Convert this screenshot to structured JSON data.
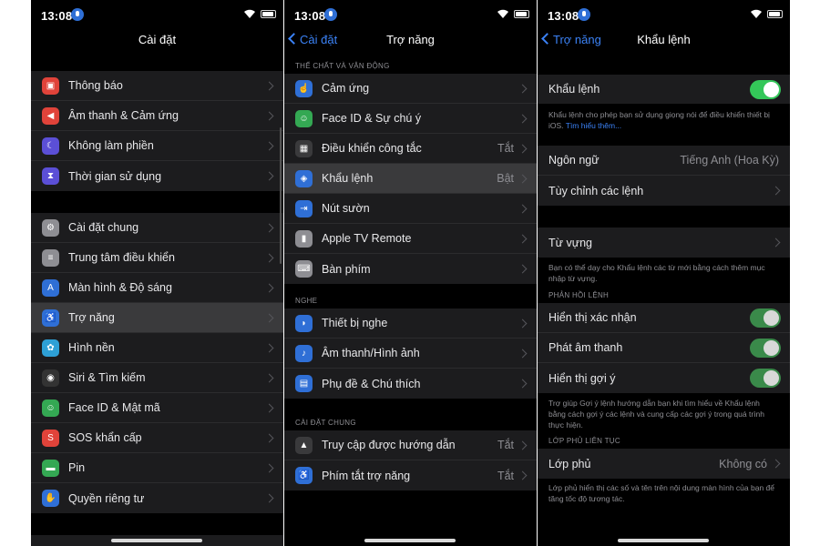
{
  "status": {
    "time": "13:08"
  },
  "screen1": {
    "title": "Cài đặt",
    "group1": [
      {
        "label": "Thông báo",
        "icon": "notification-icon",
        "color": "#e0433a"
      },
      {
        "label": "Âm thanh & Cảm ứng",
        "icon": "sound-icon",
        "color": "#e0433a"
      },
      {
        "label": "Không làm phiền",
        "icon": "moon-icon",
        "color": "#5b4fd6"
      },
      {
        "label": "Thời gian sử dụng",
        "icon": "hourglass-icon",
        "color": "#5b4fd6"
      }
    ],
    "group2": [
      {
        "label": "Cài đặt chung",
        "icon": "gear-icon",
        "color": "#8e8e93"
      },
      {
        "label": "Trung tâm điều khiển",
        "icon": "control-center-icon",
        "color": "#8e8e93"
      },
      {
        "label": "Màn hình & Độ sáng",
        "icon": "display-icon",
        "color": "#2f6fd6"
      },
      {
        "label": "Trợ năng",
        "icon": "accessibility-icon",
        "color": "#2f6fd6"
      },
      {
        "label": "Hình nền",
        "icon": "wallpaper-icon",
        "color": "#2ea0d6"
      },
      {
        "label": "Siri & Tìm kiếm",
        "icon": "siri-icon",
        "color": "#333"
      },
      {
        "label": "Face ID & Mật mã",
        "icon": "faceid-icon",
        "color": "#34a853"
      },
      {
        "label": "SOS khẩn cấp",
        "icon": "sos-icon",
        "color": "#e0433a"
      },
      {
        "label": "Pin",
        "icon": "battery-icon",
        "color": "#34a853"
      },
      {
        "label": "Quyền riêng tư",
        "icon": "privacy-hand-icon",
        "color": "#2f6fd6"
      }
    ]
  },
  "screen2": {
    "back": "Cài đặt",
    "title": "Trợ năng",
    "section1": "THỂ CHẤT VÀ VẬN ĐỘNG",
    "group1": [
      {
        "label": "Cảm ứng",
        "icon": "touch-icon",
        "color": "#2f6fd6",
        "value": ""
      },
      {
        "label": "Face ID & Sự chú ý",
        "icon": "faceid-icon",
        "color": "#34a853",
        "value": ""
      },
      {
        "label": "Điều khiển công tắc",
        "icon": "switch-control-icon",
        "color": "#3a3a3c",
        "value": "Tắt"
      },
      {
        "label": "Khẩu lệnh",
        "icon": "voice-control-icon",
        "color": "#2f6fd6",
        "value": "Bật"
      },
      {
        "label": "Nút sườn",
        "icon": "side-button-icon",
        "color": "#2f6fd6",
        "value": ""
      },
      {
        "label": "Apple TV Remote",
        "icon": "remote-icon",
        "color": "#8e8e93",
        "value": ""
      },
      {
        "label": "Bàn phím",
        "icon": "keyboard-icon",
        "color": "#8e8e93",
        "value": ""
      }
    ],
    "section2": "NGHE",
    "group2": [
      {
        "label": "Thiết bị nghe",
        "icon": "ear-icon",
        "color": "#2f6fd6",
        "value": ""
      },
      {
        "label": "Âm thanh/Hình ảnh",
        "icon": "audio-visual-icon",
        "color": "#2f6fd6",
        "value": ""
      },
      {
        "label": "Phụ đề & Chú thích",
        "icon": "subtitles-icon",
        "color": "#2f6fd6",
        "value": ""
      }
    ],
    "section3": "CÀI ĐẶT CHUNG",
    "group3": [
      {
        "label": "Truy cập được hướng dẫn",
        "icon": "lock-icon",
        "color": "#3a3a3c",
        "value": "Tắt"
      },
      {
        "label": "Phím tắt trợ năng",
        "icon": "accessibility-icon",
        "color": "#2f6fd6",
        "value": "Tắt"
      }
    ]
  },
  "screen3": {
    "back": "Trợ năng",
    "title": "Khẩu lệnh",
    "toggle_label": "Khẩu lệnh",
    "toggle_note": "Khẩu lệnh cho phép bạn sử dụng giọng nói để điều khiển thiết bị iOS.",
    "toggle_link": "Tìm hiểu thêm...",
    "language_label": "Ngôn ngữ",
    "language_value": "Tiếng Anh (Hoa Kỳ)",
    "customize_label": "Tùy chỉnh các lệnh",
    "vocab_label": "Từ vựng",
    "vocab_note": "Bạn có thể dạy cho Khẩu lệnh các từ mới bằng cách thêm mục nhập từ vựng.",
    "feedback_header": "PHẢN HỒI LỆNH",
    "confirm_label": "Hiển thị xác nhận",
    "sound_label": "Phát âm thanh",
    "hints_label": "Hiển thị gợi ý",
    "hints_note": "Trợ giúp Gợi ý lệnh hướng dẫn bạn khi tìm hiểu về Khẩu lệnh bằng cách gợi ý các lệnh và cung cấp các gợi ý trong quá trình thực hiện.",
    "overlay_header": "LỚP PHỦ LIÊN TỤC",
    "overlay_label": "Lớp phủ",
    "overlay_value": "Không có",
    "overlay_note": "Lớp phủ hiển thị các số và tên trên nội dung màn hình của bạn để tăng tốc độ tương tác."
  }
}
